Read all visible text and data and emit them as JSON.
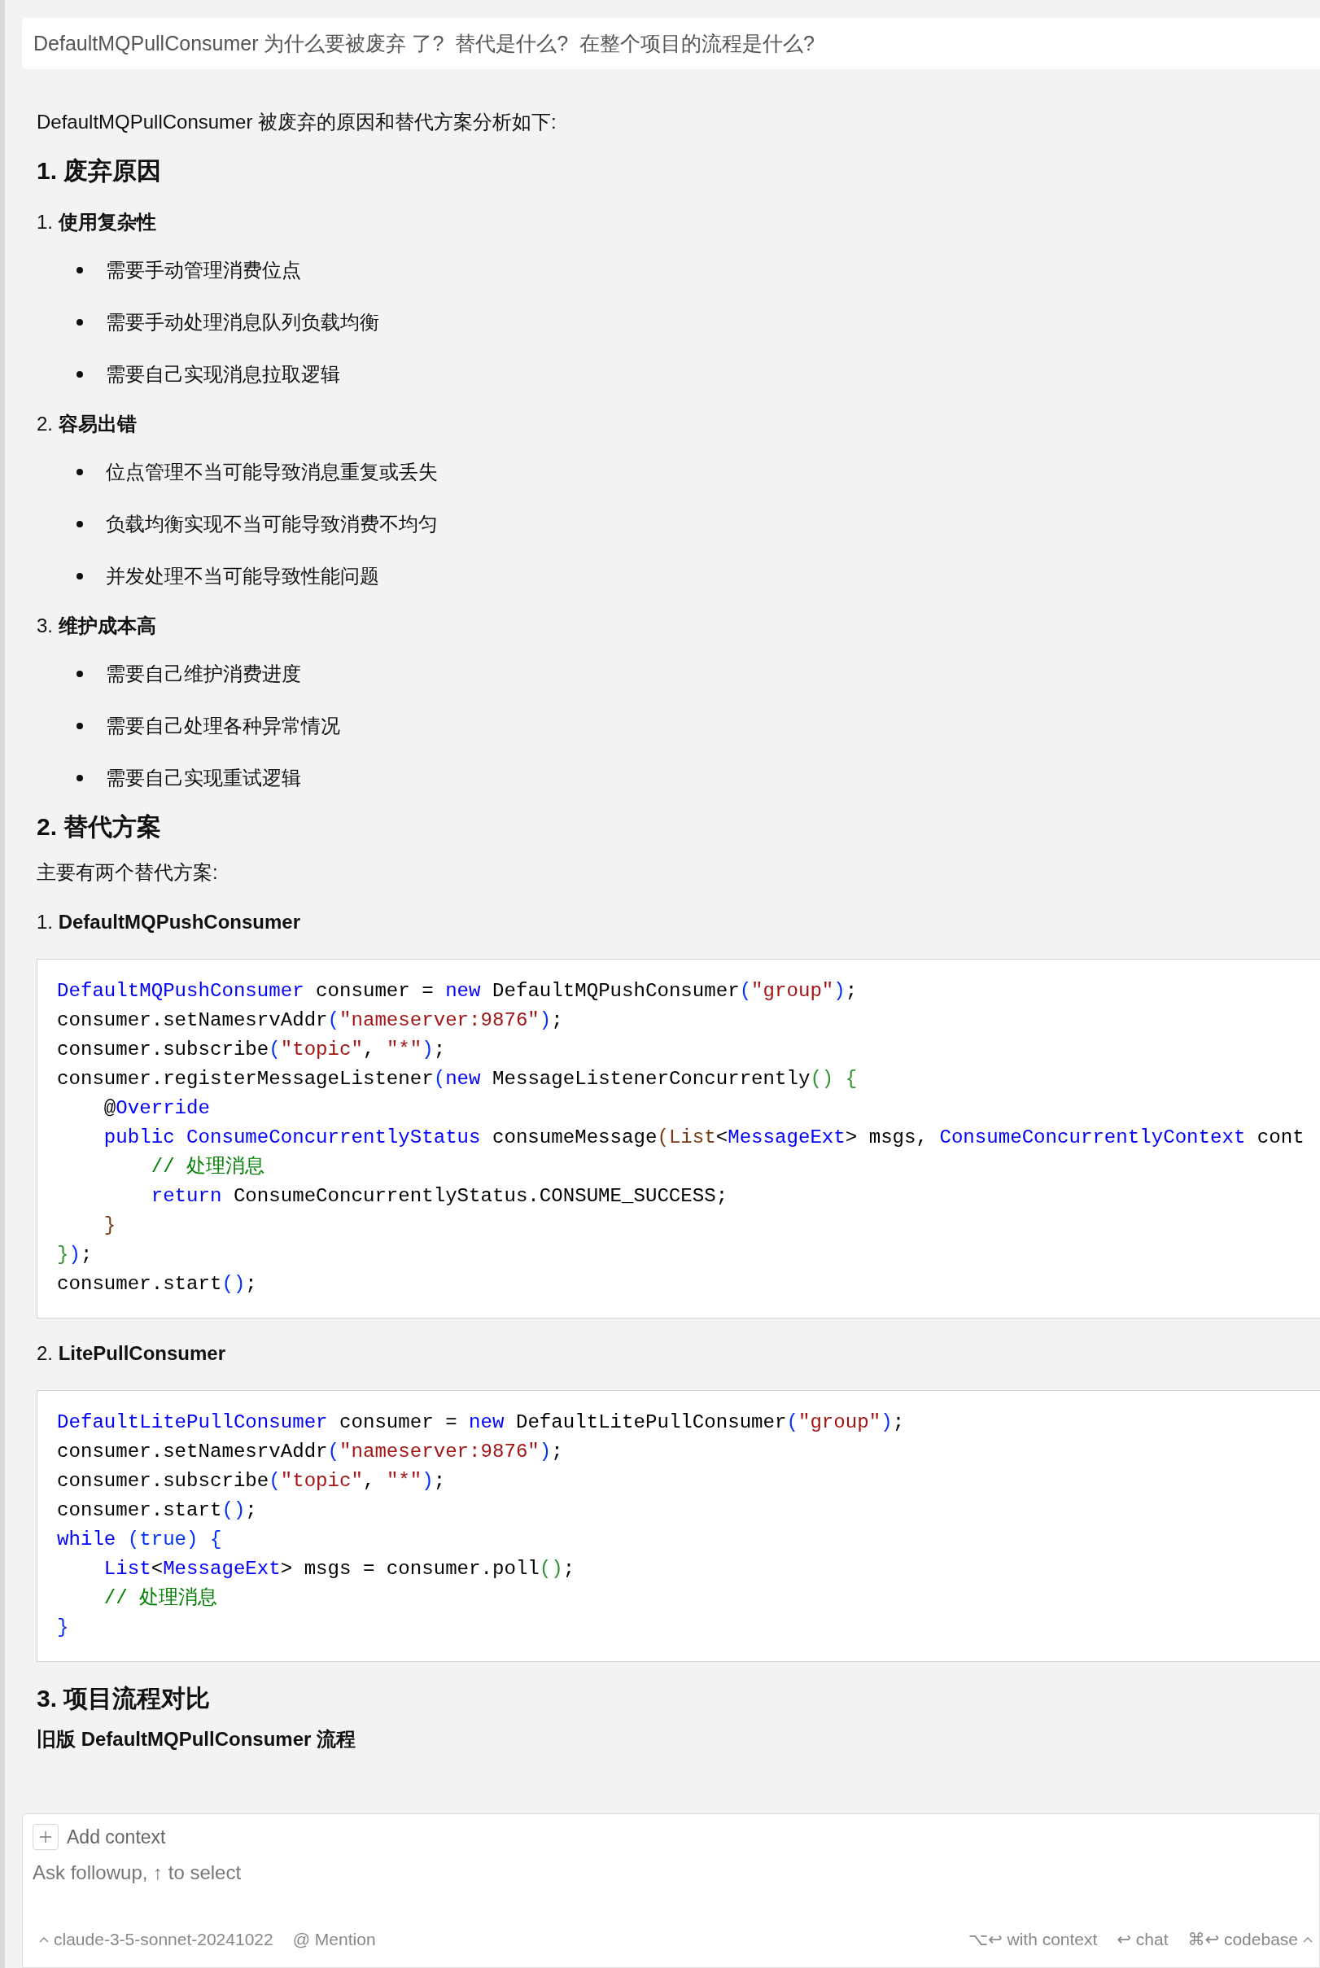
{
  "question": {
    "text": "DefaultMQPullConsumer 为什么要被废弃 了?  替代是什么?  在整个项目的流程是什么?"
  },
  "answer": {
    "blocks": [
      {
        "kind": "p",
        "text": "DefaultMQPullConsumer 被废弃的原因和替代方案分析如下:"
      },
      {
        "kind": "h",
        "text": "1. 废弃原因"
      },
      {
        "kind": "sub",
        "text": "1. **使用复杂性**"
      },
      {
        "kind": "bullet",
        "text": "需要手动管理消费位点"
      },
      {
        "kind": "bullet",
        "text": "需要手动处理消息队列负载均衡"
      },
      {
        "kind": "bullet",
        "text": "需要自己实现消息拉取逻辑"
      },
      {
        "kind": "sub",
        "text": "2. **容易出错**"
      },
      {
        "kind": "bullet",
        "text": "位点管理不当可能导致消息重复或丢失"
      },
      {
        "kind": "bullet",
        "text": "负载均衡实现不当可能导致消费不均匀"
      },
      {
        "kind": "bullet",
        "text": "并发处理不当可能导致性能问题"
      },
      {
        "kind": "sub",
        "text": "3. **维护成本高**"
      },
      {
        "kind": "bullet",
        "text": "需要自己维护消费进度"
      },
      {
        "kind": "bullet",
        "text": "需要自己处理各种异常情况"
      },
      {
        "kind": "bullet",
        "text": "需要自己实现重试逻辑"
      },
      {
        "kind": "h",
        "text": "2. 替代方案"
      },
      {
        "kind": "p",
        "text": "主要有两个替代方案:"
      },
      {
        "kind": "sub",
        "text": "1. **DefaultMQPushConsumer**"
      },
      {
        "kind": "code",
        "lines": [
          [
            {
              "kind": "kw",
              "text": "DefaultMQPushConsumer"
            },
            {
              "kind": "plain",
              "text": " consumer = "
            },
            {
              "kind": "kw",
              "text": "new"
            },
            {
              "kind": "plain",
              "text": " DefaultMQPushConsumer"
            },
            {
              "kind": "b1",
              "text": "("
            },
            {
              "kind": "str",
              "text": "\"group\""
            },
            {
              "kind": "b1",
              "text": ")"
            },
            {
              "kind": "plain",
              "text": ";"
            }
          ],
          [
            {
              "kind": "plain",
              "text": "consumer.setNamesrvAddr"
            },
            {
              "kind": "b1",
              "text": "("
            },
            {
              "kind": "str",
              "text": "\"nameserver:9876\""
            },
            {
              "kind": "b1",
              "text": ")"
            },
            {
              "kind": "plain",
              "text": ";"
            }
          ],
          [
            {
              "kind": "plain",
              "text": "consumer.subscribe"
            },
            {
              "kind": "b1",
              "text": "("
            },
            {
              "kind": "str",
              "text": "\"topic\""
            },
            {
              "kind": "plain",
              "text": ", "
            },
            {
              "kind": "str",
              "text": "\"*\""
            },
            {
              "kind": "b1",
              "text": ")"
            },
            {
              "kind": "plain",
              "text": ";"
            }
          ],
          [
            {
              "kind": "plain",
              "text": "consumer.registerMessageListener"
            },
            {
              "kind": "b1",
              "text": "("
            },
            {
              "kind": "kw",
              "text": "new"
            },
            {
              "kind": "plain",
              "text": " MessageListenerConcurrently"
            },
            {
              "kind": "b2",
              "text": "()"
            },
            {
              "kind": "b2",
              "text": " {"
            }
          ],
          [
            {
              "kind": "plain",
              "text": "    @"
            },
            {
              "kind": "kw",
              "text": "Override"
            }
          ],
          [
            {
              "kind": "kw",
              "text": "    public"
            },
            {
              "kind": "kw",
              "text": " ConsumeConcurrentlyStatus"
            },
            {
              "kind": "plain",
              "text": " consumeMessage"
            },
            {
              "kind": "b3",
              "text": "(List"
            },
            {
              "kind": "plain",
              "text": "<"
            },
            {
              "kind": "kw",
              "text": "MessageExt"
            },
            {
              "kind": "plain",
              "text": "> msgs, "
            },
            {
              "kind": "kw",
              "text": "ConsumeConcurrentlyContext"
            },
            {
              "kind": "plain",
              "text": " cont"
            }
          ],
          [
            {
              "kind": "cm",
              "text": "        // 处理消息"
            }
          ],
          [
            {
              "kind": "kw",
              "text": "        return"
            },
            {
              "kind": "plain",
              "text": " ConsumeConcurrentlyStatus.CONSUME_SUCCESS;"
            }
          ],
          [
            {
              "kind": "b3",
              "text": "    }"
            }
          ],
          [
            {
              "kind": "b2",
              "text": "}"
            },
            {
              "kind": "b1",
              "text": ")"
            },
            {
              "kind": "plain",
              "text": ";"
            }
          ],
          [
            {
              "kind": "plain",
              "text": "consumer.start"
            },
            {
              "kind": "b1",
              "text": "()"
            },
            {
              "kind": "plain",
              "text": ";"
            }
          ]
        ]
      },
      {
        "kind": "sub",
        "text": "2. **LitePullConsumer**"
      },
      {
        "kind": "code",
        "lines": [
          [
            {
              "kind": "kw",
              "text": "DefaultLitePullConsumer"
            },
            {
              "kind": "plain",
              "text": " consumer = "
            },
            {
              "kind": "kw",
              "text": "new"
            },
            {
              "kind": "plain",
              "text": " DefaultLitePullConsumer"
            },
            {
              "kind": "b1",
              "text": "("
            },
            {
              "kind": "str",
              "text": "\"group\""
            },
            {
              "kind": "b1",
              "text": ")"
            },
            {
              "kind": "plain",
              "text": ";"
            }
          ],
          [
            {
              "kind": "plain",
              "text": "consumer.setNamesrvAddr"
            },
            {
              "kind": "b1",
              "text": "("
            },
            {
              "kind": "str",
              "text": "\"nameserver:9876\""
            },
            {
              "kind": "b1",
              "text": ")"
            },
            {
              "kind": "plain",
              "text": ";"
            }
          ],
          [
            {
              "kind": "plain",
              "text": "consumer.subscribe"
            },
            {
              "kind": "b1",
              "text": "("
            },
            {
              "kind": "str",
              "text": "\"topic\""
            },
            {
              "kind": "plain",
              "text": ", "
            },
            {
              "kind": "str",
              "text": "\"*\""
            },
            {
              "kind": "b1",
              "text": ")"
            },
            {
              "kind": "plain",
              "text": ";"
            }
          ],
          [
            {
              "kind": "plain",
              "text": "consumer.start"
            },
            {
              "kind": "b1",
              "text": "()"
            },
            {
              "kind": "plain",
              "text": ";"
            }
          ],
          [
            {
              "kind": "kw",
              "text": "while"
            },
            {
              "kind": "b1",
              "text": " (true)"
            },
            {
              "kind": "b1",
              "text": " {"
            }
          ],
          [
            {
              "kind": "kw",
              "text": "    List"
            },
            {
              "kind": "plain",
              "text": "<"
            },
            {
              "kind": "kw",
              "text": "MessageExt"
            },
            {
              "kind": "plain",
              "text": "> msgs = consumer.poll"
            },
            {
              "kind": "b2",
              "text": "()"
            },
            {
              "kind": "plain",
              "text": ";"
            }
          ],
          [
            {
              "kind": "cm",
              "text": "    // 处理消息"
            }
          ],
          [
            {
              "kind": "b1",
              "text": "}"
            }
          ]
        ]
      },
      {
        "kind": "h",
        "text": "3. 项目流程对比"
      },
      {
        "kind": "strong",
        "text": "旧版 DefaultMQPullConsumer 流程"
      }
    ]
  },
  "composer": {
    "add_context": "Add context",
    "placeholder": "Ask followup, ↑ to select",
    "model": "claude-3-5-sonnet-20241022",
    "mention": "@ Mention",
    "shortcuts": [
      {
        "text": "⌥↩ with context"
      },
      {
        "text": "↩ chat"
      },
      {
        "text": "⌘↩ codebase"
      }
    ]
  }
}
